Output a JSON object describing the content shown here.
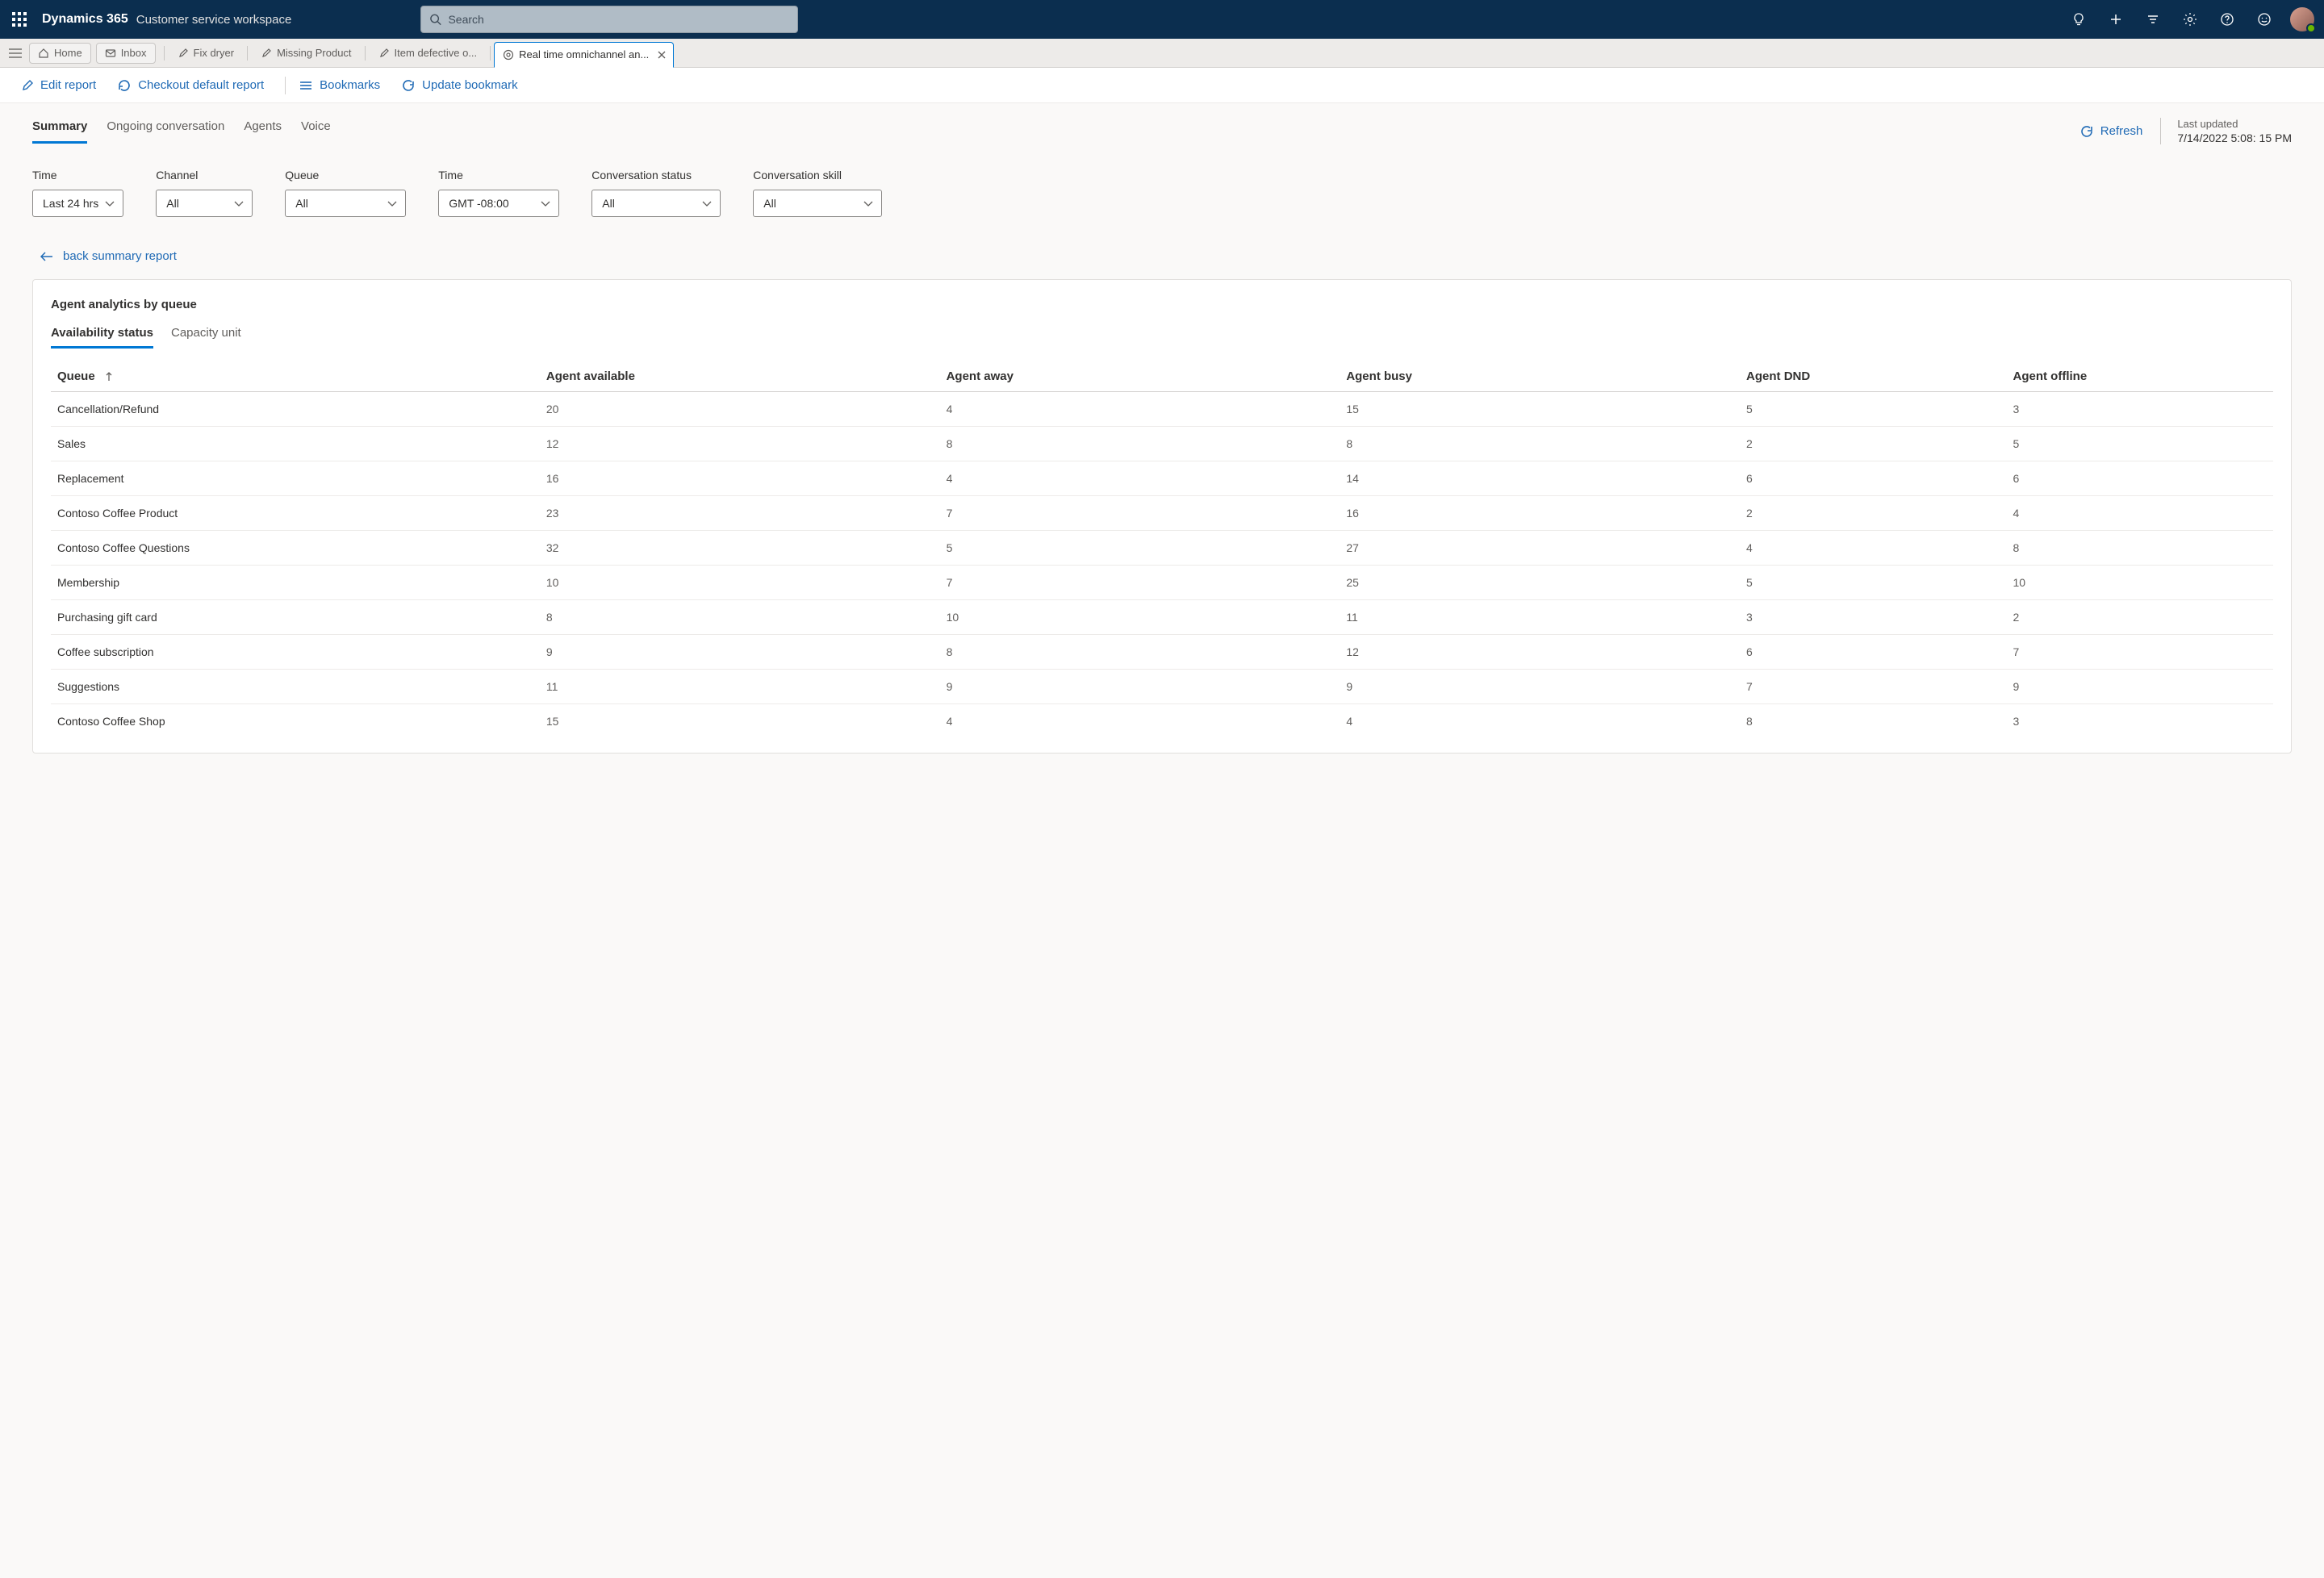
{
  "header": {
    "brand": "Dynamics 365",
    "brand_sub": "Customer service workspace",
    "search_placeholder": "Search"
  },
  "tabs": {
    "home": "Home",
    "inbox": "Inbox",
    "fix_dryer": "Fix dryer",
    "missing_product": "Missing Product",
    "item_defective": "Item defective o...",
    "active": "Real time omnichannel an..."
  },
  "commands": {
    "edit": "Edit report",
    "checkout": "Checkout default report",
    "bookmarks": "Bookmarks",
    "update": "Update bookmark"
  },
  "view_tabs": {
    "summary": "Summary",
    "ongoing": "Ongoing conversation",
    "agents": "Agents",
    "voice": "Voice"
  },
  "refresh_label": "Refresh",
  "last_updated_label": "Last updated",
  "last_updated_value": "7/14/2022 5:08: 15 PM",
  "filters": [
    {
      "label": "Time",
      "value": "Last 24 hrs",
      "w": 110
    },
    {
      "label": "Channel",
      "value": "All",
      "w": 120
    },
    {
      "label": "Queue",
      "value": "All",
      "w": 150
    },
    {
      "label": "Time",
      "value": "GMT -08:00",
      "w": 150
    },
    {
      "label": "Conversation status",
      "value": "All",
      "w": 160
    },
    {
      "label": "Conversation skill",
      "value": "All",
      "w": 160
    }
  ],
  "back_label": "back summary report",
  "card_title": "Agent analytics by queue",
  "inner_tabs": {
    "availability": "Availability status",
    "capacity": "Capacity unit"
  },
  "table": {
    "columns": [
      "Queue",
      "Agent available",
      "Agent away",
      "Agent busy",
      "Agent DND",
      "Agent offline"
    ],
    "rows": [
      {
        "queue": "Cancellation/Refund",
        "available": 20,
        "away": 4,
        "busy": 15,
        "dnd": 5,
        "offline": 3
      },
      {
        "queue": "Sales",
        "available": 12,
        "away": 8,
        "busy": 8,
        "dnd": 2,
        "offline": 5
      },
      {
        "queue": "Replacement",
        "available": 16,
        "away": 4,
        "busy": 14,
        "dnd": 6,
        "offline": 6
      },
      {
        "queue": "Contoso Coffee Product",
        "available": 23,
        "away": 7,
        "busy": 16,
        "dnd": 2,
        "offline": 4
      },
      {
        "queue": "Contoso Coffee Questions",
        "available": 32,
        "away": 5,
        "busy": 27,
        "dnd": 4,
        "offline": 8
      },
      {
        "queue": "Membership",
        "available": 10,
        "away": 7,
        "busy": 25,
        "dnd": 5,
        "offline": 10
      },
      {
        "queue": "Purchasing gift card",
        "available": 8,
        "away": 10,
        "busy": 11,
        "dnd": 3,
        "offline": 2
      },
      {
        "queue": "Coffee subscription",
        "available": 9,
        "away": 8,
        "busy": 12,
        "dnd": 6,
        "offline": 7
      },
      {
        "queue": "Suggestions",
        "available": 11,
        "away": 9,
        "busy": 9,
        "dnd": 7,
        "offline": 9
      },
      {
        "queue": "Contoso Coffee Shop",
        "available": 15,
        "away": 4,
        "busy": 4,
        "dnd": 8,
        "offline": 3
      }
    ]
  }
}
